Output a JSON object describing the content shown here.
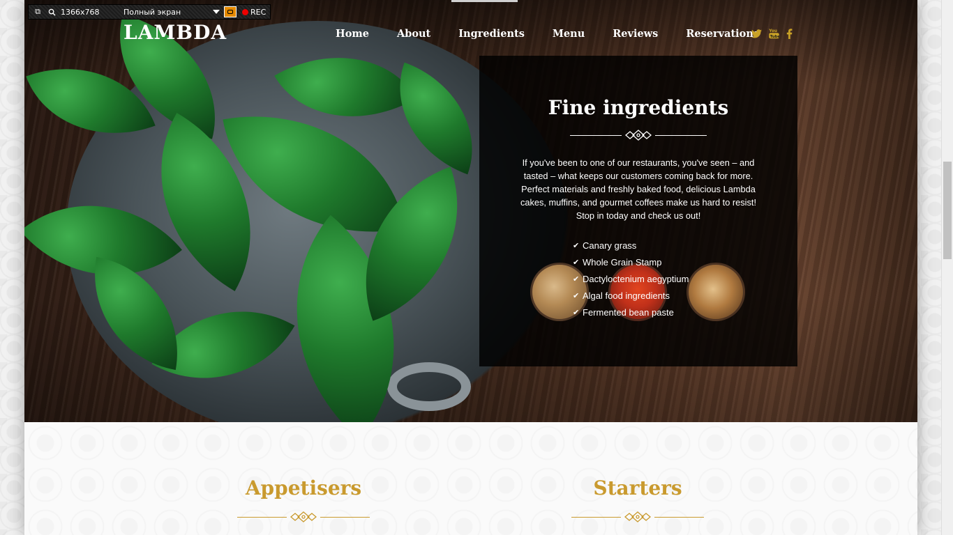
{
  "recorder": {
    "resolution": "1366x768",
    "mode": "Полный экран",
    "rec_label": "REC"
  },
  "brand": {
    "logo": "LAMBDA"
  },
  "nav": {
    "items": [
      {
        "label": "Home"
      },
      {
        "label": "About"
      },
      {
        "label": "Ingredients"
      },
      {
        "label": "Menu"
      },
      {
        "label": "Reviews"
      },
      {
        "label": "Reservations"
      }
    ],
    "active": "Ingredients"
  },
  "social": {
    "twitter_icon": "twitter-icon",
    "youtube_icon": "youtube-icon",
    "facebook_icon": "facebook-icon",
    "twitter_glyph": "🐦",
    "youtube_glyph": "▶",
    "facebook_glyph": "f"
  },
  "panel": {
    "title": "Fine ingredients",
    "text": "If you've been to one of our restaurants, you've seen – and tasted – what keeps our customers coming back for more. Perfect materials and freshly baked food, delicious Lambda cakes, muffins, and gourmet coffees make us hard to resist! Stop in today and check us out!",
    "ingredients": [
      "Canary grass",
      "Whole Grain Stamp",
      "Dactyloctenium aegyptium",
      "Algal food ingredients",
      "Fermented bean paste"
    ]
  },
  "sections": {
    "appetisers": "Appetisers",
    "starters": "Starters"
  },
  "colors": {
    "accent": "#c99a2e",
    "social": "#c9a227",
    "panel_bg": "#000000"
  }
}
